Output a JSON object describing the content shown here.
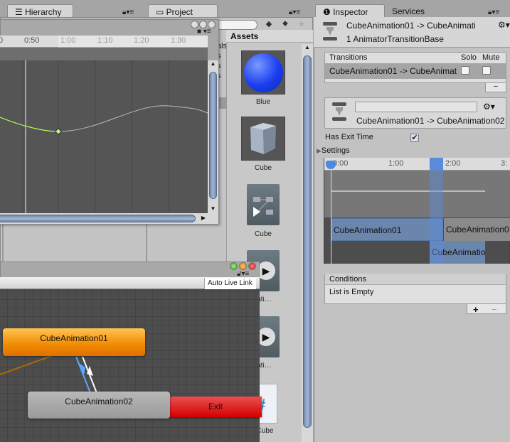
{
  "tabs": {
    "hierarchy": "Hierarchy",
    "project": "Project",
    "inspector": "Inspector",
    "services": "Services"
  },
  "curve": {
    "ticks": [
      "0",
      "0:50",
      "1:00",
      "1:10",
      "1:20",
      "1:30"
    ],
    "behind_text": [
      "als",
      "s",
      "s",
      "s"
    ],
    "curve_color": "#b4ff50"
  },
  "project": {
    "assets_header": "Assets",
    "assets": [
      {
        "label": "Blue",
        "icon": "material-sphere-icon"
      },
      {
        "label": "Cube",
        "icon": "cube-mesh-icon"
      },
      {
        "label": "Cube",
        "icon": "animator-controller-icon"
      },
      {
        "label": "nimati…",
        "icon": "animation-clip-icon"
      },
      {
        "label": "nimati…",
        "icon": "animation-clip-icon"
      },
      {
        "label": "oCube",
        "icon": "csharp-script-icon"
      }
    ]
  },
  "animator": {
    "auto_live_link": "Auto Live Link",
    "nodes": {
      "state1": "CubeAnimation01",
      "state2": "CubeAnimation02",
      "exit": "Exit"
    },
    "colors": {
      "default_state": "#f08a00",
      "state": "#a0a0a0",
      "exit": "#dd1010",
      "transition": "#5aa8ff"
    }
  },
  "inspector": {
    "title": "CubeAnimation01 -> CubeAnimati",
    "subtitle": "1 AnimatorTransitionBase",
    "transitions": {
      "header": "Transitions",
      "solo": "Solo",
      "mute": "Mute",
      "row": "CubeAnimation01 -> CubeAnimat",
      "solo_checked": false,
      "mute_checked": false,
      "minus": "−"
    },
    "transition_name_value": "",
    "transition_label": "CubeAnimation01 -> CubeAnimation02",
    "has_exit_time": {
      "label": "Has Exit Time",
      "checked": true
    },
    "settings": "Settings",
    "timeline": {
      "ticks": [
        "0:00",
        "1:00",
        "2:00",
        "3:"
      ],
      "clip1": "CubeAnimation01",
      "clip2": "CubeAnimation0",
      "clip3": "CubeAnimatio"
    },
    "conditions": {
      "header": "Conditions",
      "empty": "List is Empty",
      "plus": "+",
      "minus": "−"
    }
  }
}
